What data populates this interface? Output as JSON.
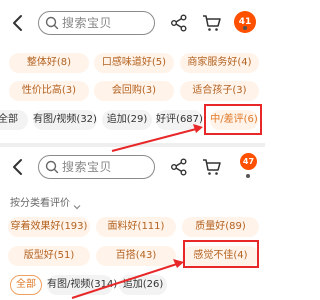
{
  "top_panel": {
    "header": {
      "search_placeholder": "搜索宝贝",
      "message_count": "41"
    },
    "tags": [
      {
        "label": "整体好(8)"
      },
      {
        "label": "口感味道好(5)"
      },
      {
        "label": "商家服务好(4)"
      },
      {
        "label": "性价比高(3)"
      },
      {
        "label": "会回购(3)"
      },
      {
        "label": "适合孩子(3)"
      }
    ],
    "tabs": [
      {
        "label": "全部"
      },
      {
        "label": "有图/视频(32)"
      },
      {
        "label": "追加(29)"
      },
      {
        "label": "好评(687)"
      },
      {
        "label": "中/差评(6)"
      }
    ]
  },
  "bottom_panel": {
    "header": {
      "search_placeholder": "搜索宝贝",
      "message_count": "47"
    },
    "section_title": "按分类看评价",
    "tags": [
      {
        "label": "穿着效果好(193)"
      },
      {
        "label": "面料好(111)"
      },
      {
        "label": "质量好(89)"
      },
      {
        "label": "版型好(51)"
      },
      {
        "label": "百搭(43)"
      },
      {
        "label": "感觉不佳(4)"
      }
    ],
    "tabs": [
      {
        "label": "全部"
      },
      {
        "label": "有图/视频(314)"
      },
      {
        "label": "追加(26)"
      }
    ]
  },
  "colors": {
    "accent": "#ff5000",
    "tag_bg": "#fff3ea",
    "tag_text": "#b3621f",
    "highlight": "#e82828"
  }
}
